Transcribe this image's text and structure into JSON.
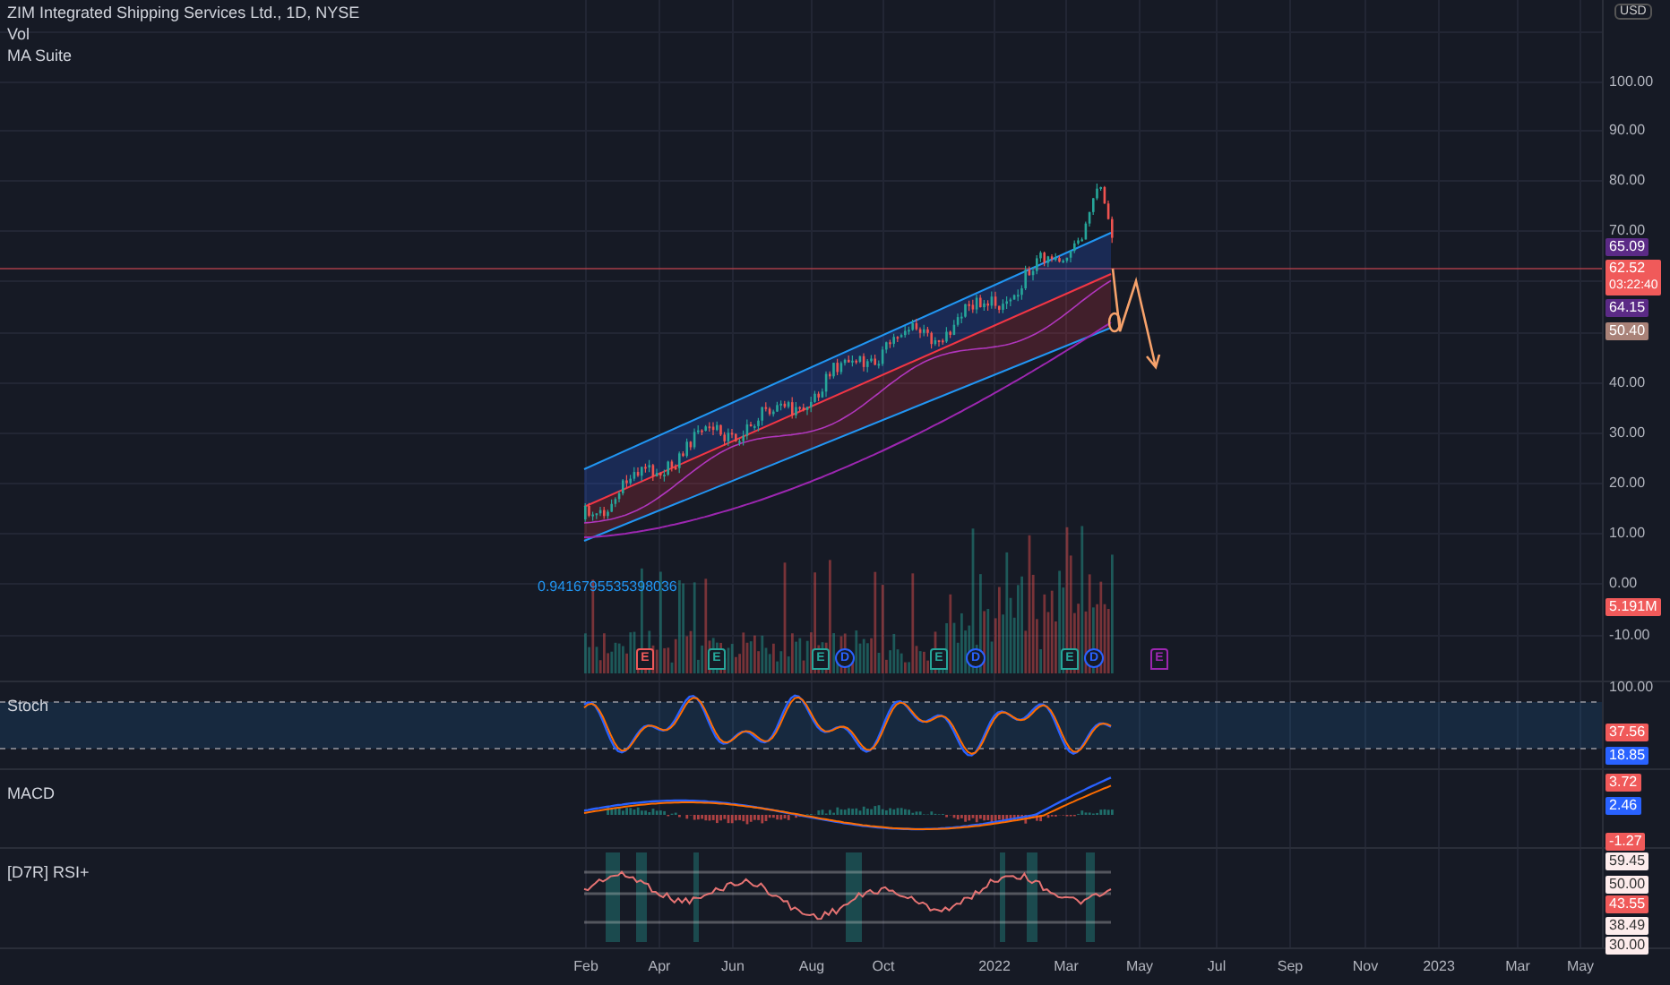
{
  "legend": {
    "symbol": "ZIM Integrated Shipping Services Ltd., 1D, NYSE",
    "indicators": [
      "Vol",
      "MA Suite"
    ]
  },
  "channel_label": "0.9416795535398036",
  "currency": "USD",
  "events": [
    {
      "letter": "E",
      "color": "#f05a5a"
    },
    {
      "letter": "E",
      "color": "#26a69a"
    },
    {
      "letter": "E",
      "color": "#26a69a"
    },
    {
      "letter": "D",
      "color": "#2962ff"
    },
    {
      "letter": "E",
      "color": "#26a69a"
    },
    {
      "letter": "D",
      "color": "#2962ff"
    },
    {
      "letter": "E",
      "color": "#26a69a"
    },
    {
      "letter": "D",
      "color": "#2962ff"
    },
    {
      "letter": "E",
      "color": "#9c27b0"
    }
  ],
  "panes": [
    {
      "kind": "price",
      "scale": [
        {
          "text": "100.00",
          "kind": "tick"
        },
        {
          "text": "90.00",
          "kind": "tick"
        },
        {
          "text": "80.00",
          "kind": "tick"
        },
        {
          "text": "70.00",
          "kind": "tick"
        },
        {
          "text": "65.09",
          "kind": "tag",
          "color": "#5b2a86"
        },
        {
          "text": "62.52",
          "kind": "tag",
          "color": "#f05a5a",
          "sub": "03:22:40"
        },
        {
          "text": "64.15",
          "kind": "tag",
          "color": "#5b2a86"
        },
        {
          "text": "50.40",
          "kind": "tag",
          "color": "#a98278"
        },
        {
          "text": "40.00",
          "kind": "tick"
        },
        {
          "text": "30.00",
          "kind": "tick"
        },
        {
          "text": "20.00",
          "kind": "tick"
        },
        {
          "text": "10.00",
          "kind": "tick"
        },
        {
          "text": "0.00",
          "kind": "tick"
        },
        {
          "text": "5.191M",
          "kind": "tag",
          "color": "#f05a5a"
        },
        {
          "text": "-10.00",
          "kind": "tick"
        }
      ]
    },
    {
      "kind": "stoch",
      "title": "Stoch",
      "scale": [
        {
          "text": "100.00",
          "kind": "tick"
        },
        {
          "text": "37.56",
          "kind": "tag",
          "color": "#f05a5a"
        },
        {
          "text": "18.85",
          "kind": "tag",
          "color": "#2962ff"
        }
      ]
    },
    {
      "kind": "macd",
      "title": "MACD",
      "scale": [
        {
          "text": "3.72",
          "kind": "tag",
          "color": "#f05a5a"
        },
        {
          "text": "2.46",
          "kind": "tag",
          "color": "#2962ff"
        },
        {
          "text": "-1.27",
          "kind": "tag",
          "color": "#f05a5a"
        }
      ]
    },
    {
      "kind": "rsi",
      "title": "[D7R] RSI+",
      "scale": [
        {
          "text": "59.45",
          "kind": "boxed"
        },
        {
          "text": "50.00",
          "kind": "boxed"
        },
        {
          "text": "43.55",
          "kind": "tag",
          "color": "#f05a5a"
        },
        {
          "text": "38.49",
          "kind": "boxed"
        },
        {
          "text": "30.00",
          "kind": "boxed"
        }
      ]
    }
  ],
  "x_axis": [
    "Feb",
    "Apr",
    "Jun",
    "Aug",
    "Oct",
    "2022",
    "Mar",
    "May",
    "Jul",
    "Sep",
    "Nov",
    "2023",
    "Mar",
    "May"
  ]
}
